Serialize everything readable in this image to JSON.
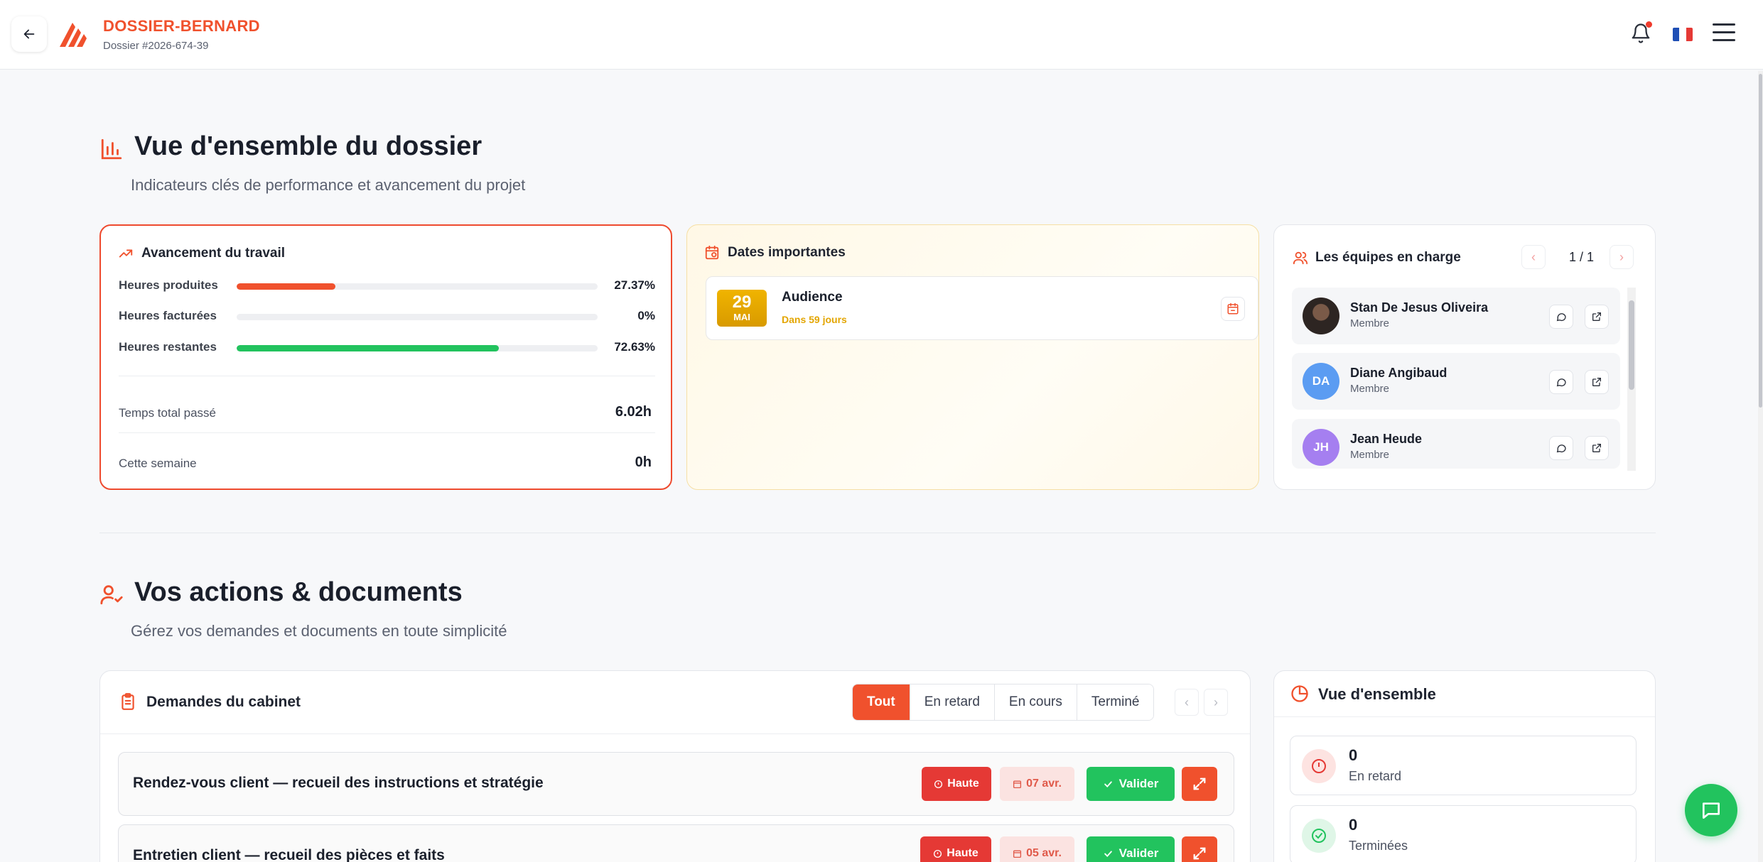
{
  "header": {
    "brand_name": "DOSSIER-BERNARD",
    "dossier_ref": "Dossier #2026-674-39",
    "language_flag": "fr-flag"
  },
  "overview_section": {
    "title": "Vue d'ensemble du dossier",
    "subtitle": "Indicateurs clés de performance et avancement du projet"
  },
  "progress_card": {
    "title": "Avancement du travail",
    "rows": [
      {
        "label": "Heures produites",
        "value": "27.37%",
        "fraction": 0.2737,
        "color": "#f0512d"
      },
      {
        "label": "Heures facturées",
        "value": "0%",
        "fraction": 0,
        "color": "#f0512d"
      },
      {
        "label": "Heures restantes",
        "value": "72.63%",
        "fraction": 0.7263,
        "color": "#22c35e"
      }
    ],
    "total_label": "Temps total passé",
    "total_value": "6.02h",
    "week_label": "Cette semaine",
    "week_value": "0h"
  },
  "dates_card": {
    "title": "Dates importantes",
    "items": [
      {
        "day": "29",
        "month": "MAI",
        "title": "Audience",
        "subtitle": "Dans 59 jours"
      }
    ]
  },
  "teams_card": {
    "title": "Les équipes en charge",
    "pager": "1 / 1",
    "members": [
      {
        "name": "Stan De Jesus Oliveira",
        "role": "Membre",
        "initials": "",
        "color": "#2b2b2b"
      },
      {
        "name": "Diane Angibaud",
        "role": "Membre",
        "initials": "DA",
        "color": "#5b9cf2"
      },
      {
        "name": "Jean Heude",
        "role": "Membre",
        "initials": "JH",
        "color": "#a57ff0"
      }
    ]
  },
  "actions_section": {
    "title": "Vos actions & documents",
    "subtitle": "Gérez vos demandes et documents en toute simplicité"
  },
  "requests_card": {
    "title": "Demandes du cabinet",
    "tabs": [
      "Tout",
      "En retard",
      "En cours",
      "Terminé"
    ],
    "active_tab": "Tout",
    "items": [
      {
        "title": "Rendez-vous client — recueil des instructions et stratégie",
        "priority": "Haute",
        "due": "07 avr.",
        "action": "Valider"
      },
      {
        "title": "Entretien client — recueil des pièces et faits",
        "priority": "Haute",
        "due": "05 avr.",
        "action": "Valider"
      }
    ]
  },
  "summary_card": {
    "title": "Vue d'ensemble",
    "items": [
      {
        "count": "0",
        "label": "En retard"
      },
      {
        "count": "0",
        "label": "Terminées"
      }
    ]
  },
  "colors": {
    "accent": "#f0512d",
    "success": "#22c35e",
    "danger": "#e53935",
    "warning": "#e3a500"
  }
}
